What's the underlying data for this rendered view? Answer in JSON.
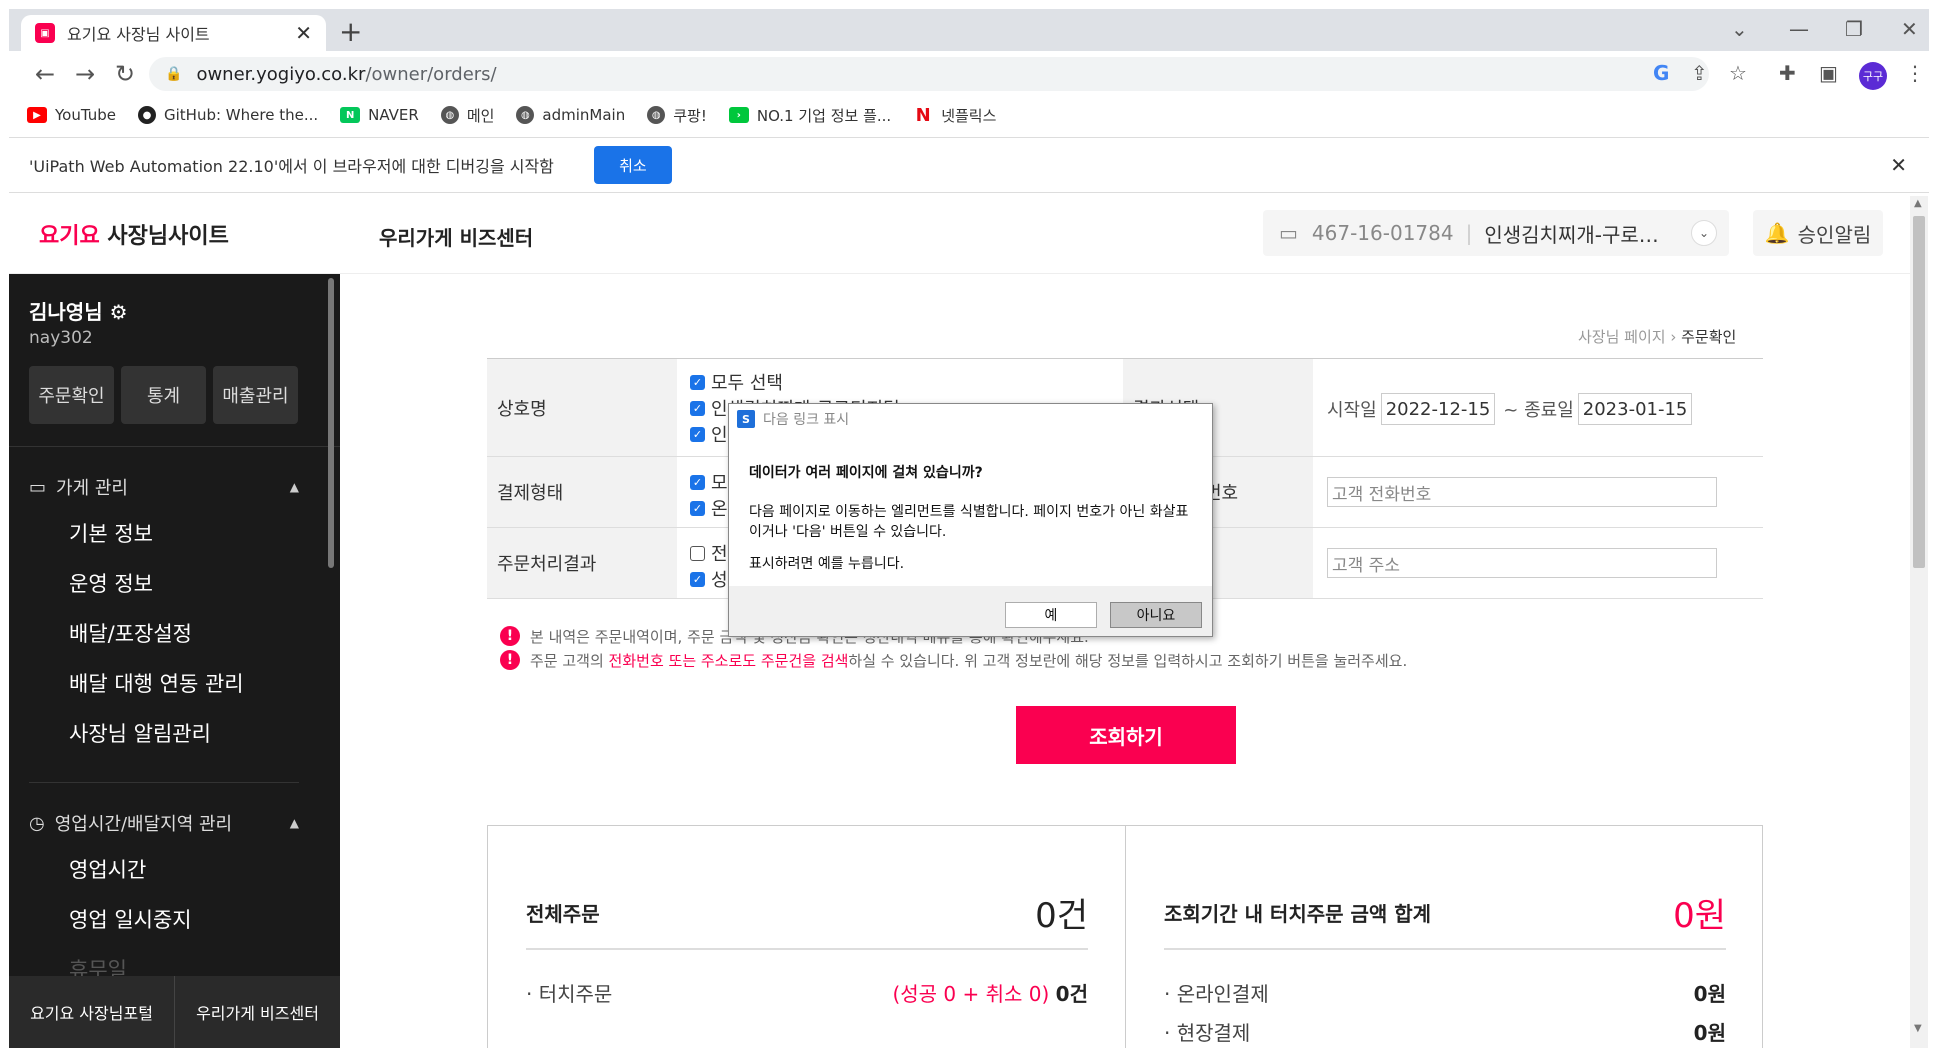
{
  "browser": {
    "tab_title": "요기요 사장님 사이트",
    "tab_close": "✕",
    "new_tab": "+",
    "url_host": "owner.yogiyo.co.kr",
    "url_path": "/owner/orders/",
    "avatar_text": "구구",
    "bookmarks": [
      "YouTube",
      "GitHub: Where the...",
      "NAVER",
      "메인",
      "adminMain",
      "쿠팡!",
      "NO.1 기업 정보 플...",
      "넷플릭스"
    ],
    "infobar_text": "'UiPath Web Automation 22.10'에서 이 브라우저에 대한 디버깅을 시작함",
    "infobar_cancel": "취소"
  },
  "header": {
    "logo_brand": "요기요",
    "logo_rest": " 사장님사이트",
    "title": "우리가게 비즈센터",
    "biz_no": "467-16-01784",
    "store_name": "인생김치찌개-구로…",
    "alarm_label": "승인알림"
  },
  "sidebar": {
    "user_name": "김나영님",
    "user_id": "nay302",
    "buttons": [
      "주문확인",
      "통계",
      "매출관리"
    ],
    "group1": "가게 관리",
    "group1_items": [
      "기본 정보",
      "운영 정보",
      "배달/포장설정",
      "배달 대행 연동 관리",
      "사장님 알림관리"
    ],
    "group2": "영업시간/배달지역 관리",
    "group2_items": [
      "영업시간",
      "영업 일시중지",
      "휴무일"
    ],
    "footer": [
      "요기요 사장님포털",
      "우리가게 비즈센터"
    ]
  },
  "breadcrumb": {
    "parent": "사장님 페이지",
    "current": "주문확인"
  },
  "filter": {
    "row1_label": "상호명",
    "row1_checks": [
      "모두 선택",
      "인생김치찌개-구로디지털",
      "인"
    ],
    "row1_label2": "결과선택",
    "start_label": "시작일",
    "start_date": "2022-12-15",
    "end_label": "~ 종료일",
    "end_date": "2023-01-15",
    "row2_label": "결제형태",
    "row2_checks": [
      "모",
      "온"
    ],
    "row2_label2": "고객 전화번호",
    "phone_placeholder": "고객 전화번호",
    "row3_label": "주문처리결과",
    "row3_checks": [
      "전",
      "성"
    ],
    "row3_label2": "고객 주소",
    "address_placeholder": "고객 주소"
  },
  "notes": {
    "note1": "본 내역은 주문내역이며, 주문 금액 및 정산금 확인은 정산내역 메뉴를 통해 확인해주세요.",
    "note2_a": "주문 고객의 ",
    "note2_hl": "전화번호 또는 주소로도 주문건을 검색",
    "note2_b": "하실 수 있습니다. 위 고객 정보란에 해당 정보를 입력하시고 조회하기 버튼을 눌러주세요."
  },
  "search_button": "조회하기",
  "summary": {
    "total_title": "전체주문",
    "total_value": "0건",
    "touch_label": "· 터치주문",
    "touch_detail": "(성공 0 + 취소 0)",
    "touch_value": "0건",
    "amount_title": "조회기간 내 터치주문 금액 합계",
    "amount_value": "0원",
    "online_label": "· 온라인결제",
    "online_value": "0원",
    "onsite_label": "· 현장결제",
    "onsite_value": "0원"
  },
  "dialog": {
    "title": "다음 링크 표시",
    "question": "데이터가 여러 페이지에 걸쳐 있습니까?",
    "para1": "다음 페이지로 이동하는 엘리먼트를 식별합니다. 페이지 번호가 아닌 화살표이거나 '다음' 버튼일 수 있습니다.",
    "para2": "표시하려면 예를 누릅니다.",
    "yes": "예",
    "no": "아니요"
  },
  "colors": {
    "brand": "#fa0050",
    "sidebar_bg": "#1a1a1a",
    "infobar_button": "#1a73e8"
  }
}
